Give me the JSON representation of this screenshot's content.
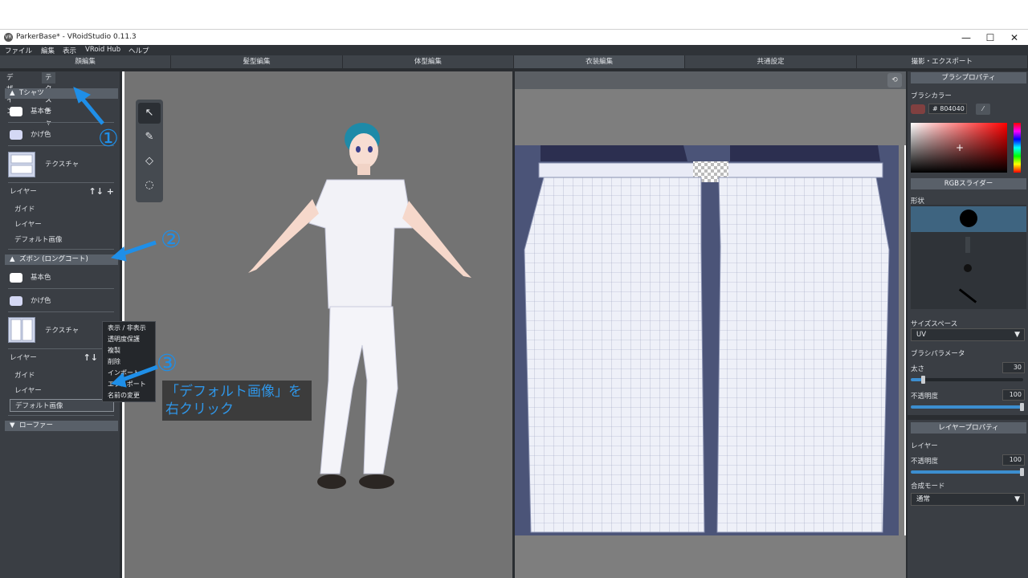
{
  "window": {
    "app_icon_text": "VR",
    "title": "ParkerBase* - VRoidStudio 0.11.3",
    "minimize": "—",
    "maximize": "☐",
    "close": "✕"
  },
  "menu": {
    "file": "ファイル",
    "edit": "編集",
    "view": "表示",
    "hub": "VRoid Hub",
    "help": "ヘルプ"
  },
  "modes": [
    "顔編集",
    "髪型編集",
    "体型編集",
    "衣装編集",
    "共通設定",
    "撮影・エクスポート"
  ],
  "left": {
    "tab_design": "デザイン",
    "tab_texture": "テクスチャ",
    "tshirt": {
      "title": "Tシャツ",
      "base_color": "基本色",
      "shadow_color": "かげ色",
      "texture": "テクスチャ",
      "layer": "レイヤー",
      "layer_buttons": "↑↓ +",
      "layers": [
        "ガイド",
        "レイヤー",
        "デフォルト画像"
      ]
    },
    "pants": {
      "title": "ズボン (ロングコート)",
      "base_color": "基本色",
      "shadow_color": "かげ色",
      "texture": "テクスチャ",
      "layer": "レイヤー",
      "layer_buttons": "↑↓",
      "layers": [
        "ガイド",
        "レイヤー",
        "デフォルト画像"
      ]
    },
    "loafer": {
      "title": "ローファー"
    }
  },
  "context_menu": [
    "表示 / 非表示",
    "透明度保護",
    "複製",
    "削除",
    "インポート",
    "エクスポート",
    "名前の変更"
  ],
  "annotations": {
    "n1": "①",
    "n2": "②",
    "n3": "③",
    "callout_line1": "「デフォルト画像」を",
    "callout_line2": "右クリック"
  },
  "right": {
    "brush_props": "ブラシプロパティ",
    "brush_color": "ブラシカラー",
    "hex_value": "# 804040",
    "brush_color_hex": "#804040",
    "rgb_slider": "RGBスライダー",
    "shape": "形状",
    "size_space": "サイズスペース",
    "size_space_value": "UV",
    "brush_params": "ブラシパラメータ",
    "thickness": "太さ",
    "thickness_value": "30",
    "opacity": "不透明度",
    "opacity_value": "100",
    "layer_props": "レイヤープロパティ",
    "layer": "レイヤー",
    "layer_opacity": "不透明度",
    "layer_opacity_value": "100",
    "blend_mode": "合成モード",
    "blend_mode_value": "通常"
  },
  "colors": {
    "accent_blue": "#1f8fe8",
    "base_white": "#ffffff",
    "shadow_lavender": "#d4d8f4",
    "panel_dark": "#3a3e44"
  }
}
